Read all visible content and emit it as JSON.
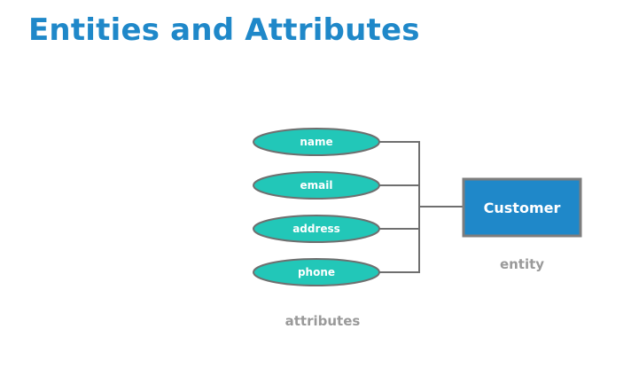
{
  "title": "Entities and Attributes",
  "colors": {
    "title": "#1f88c9",
    "attribute_fill": "#22c7b8",
    "attribute_stroke": "#6f6f6f",
    "entity_fill": "#1f88c9",
    "entity_stroke": "#7d7d7d",
    "connector": "#6f6f6f",
    "caption": "#9a9a9a"
  },
  "diagram": {
    "attributes": [
      {
        "label": "name"
      },
      {
        "label": "email"
      },
      {
        "label": "address"
      },
      {
        "label": "phone"
      }
    ],
    "attributes_caption": "attributes",
    "entity": {
      "label": "Customer"
    },
    "entity_caption": "entity"
  }
}
